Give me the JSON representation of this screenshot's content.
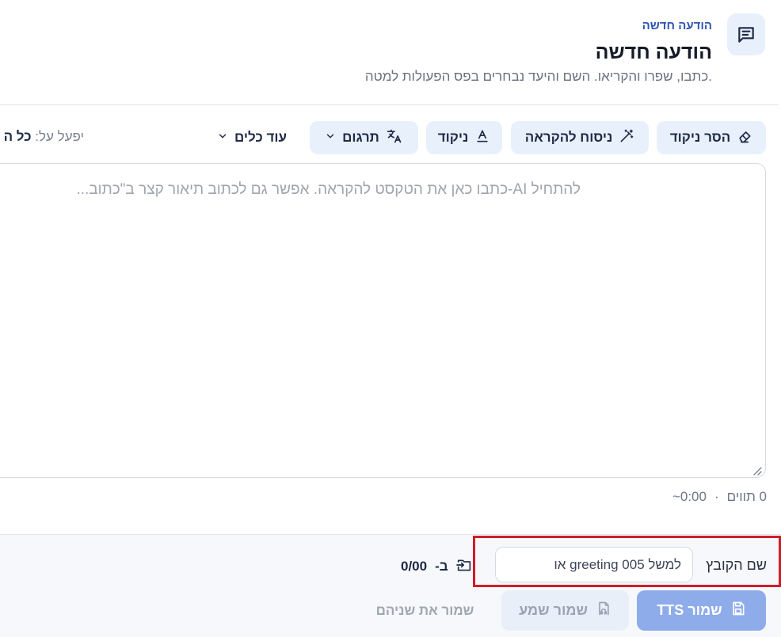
{
  "header": {
    "kicker": "הודעה חדשה",
    "title": "הודעה חדשה",
    "subtitle": "כתבו, שפרו והקריאו. השם והיעד נבחרים בפס הפעולות למטה.",
    "icon": "message-square-icon"
  },
  "toolbar": {
    "remove_niqqud": {
      "label": "הסר ניקוד",
      "icon": "eraser-icon"
    },
    "rephrase": {
      "label": "ניסוח להקראה",
      "icon": "magic-wand-icon"
    },
    "niqqud": {
      "label": "ניקוד",
      "icon": "niqqud-icon"
    },
    "translate": {
      "label": "תרגום",
      "icon": "translate-icon"
    },
    "more_tools": "עוד כלים",
    "applies_prefix": "יפעל על:",
    "applies_scope": "כל ה"
  },
  "editor": {
    "placeholder": "להתחיל AI-כתבו כאן את הטקסט להקראה. אפשר גם לכתוב תיאור קצר ב\"כתוב..."
  },
  "counter": {
    "chars": "0 תווים",
    "separator": "·",
    "duration": "~0:00"
  },
  "footer": {
    "filename_label": "שם הקובץ",
    "filename_placeholder": "למשל greeting 005 או",
    "filename_value": "",
    "progress_prefix": "ב-",
    "progress_value": "0/00",
    "save_tts": "שמור TTS",
    "save_audio": "שמור שמע",
    "save_both": "שמור את שניהם"
  },
  "colors": {
    "accent": "#2f55b5",
    "chip_bg": "#e8f0fc",
    "primary_button": "#8eacea",
    "highlight_border": "#d01e28"
  }
}
